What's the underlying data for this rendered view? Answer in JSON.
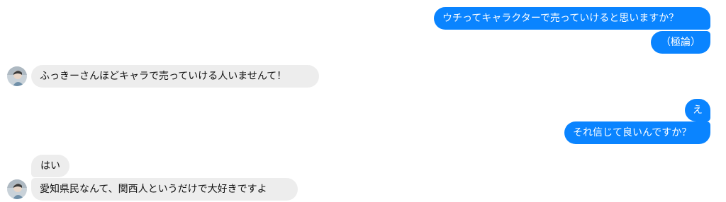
{
  "conversation": {
    "messages": [
      {
        "sender": "self",
        "text": "ウチってキャラクターで売っていけると思いますか？"
      },
      {
        "sender": "self",
        "text": "（極論）"
      },
      {
        "sender": "other",
        "text": "ふっきーさんほどキャラで売っていける人いませんて！"
      },
      {
        "sender": "self",
        "text": "え"
      },
      {
        "sender": "self",
        "text": "それ信じて良いんですか？"
      },
      {
        "sender": "other",
        "text": "はい"
      },
      {
        "sender": "other",
        "text": "愛知県民なんて、関西人というだけで大好きですよ"
      }
    ]
  },
  "colors": {
    "sent_bubble": "#0a84ff",
    "received_bubble": "#ededed"
  },
  "icons": {
    "avatar": "user-avatar-photo"
  }
}
